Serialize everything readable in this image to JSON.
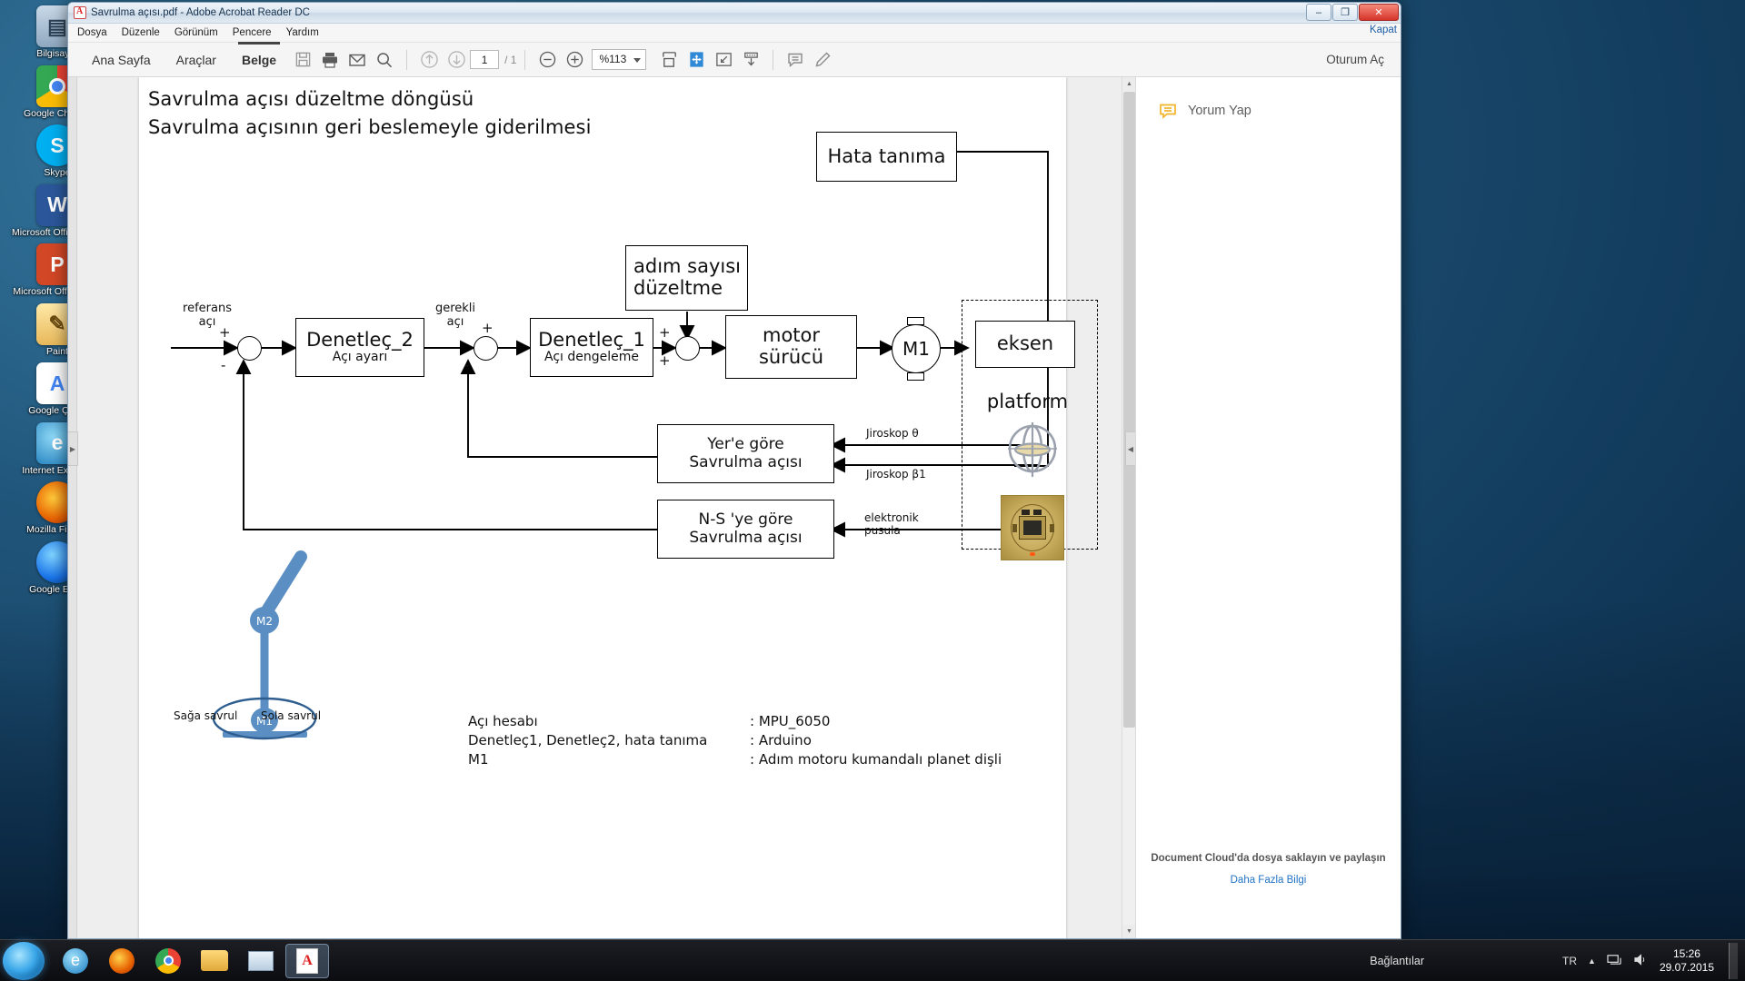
{
  "window": {
    "title": "Savrulma açısı.pdf - Adobe Acrobat Reader DC",
    "minimize": "–",
    "maximize": "❐",
    "close": "✕",
    "kapat_label": "Kapat"
  },
  "menubar": {
    "items": [
      "Dosya",
      "Düzenle",
      "Görünüm",
      "Pencere",
      "Yardım"
    ]
  },
  "toolbar": {
    "tabs": [
      {
        "label": "Ana Sayfa",
        "active": false
      },
      {
        "label": "Araçlar",
        "active": false
      },
      {
        "label": "Belge",
        "active": true
      }
    ],
    "page_current": "1",
    "page_total": "/ 1",
    "zoom_value": "%113",
    "sign_in": "Oturum Aç",
    "icons": [
      "save-icon",
      "print-icon",
      "email-icon",
      "search-icon",
      "previous-page-icon",
      "next-page-icon",
      "zoom-out-icon",
      "zoom-in-icon",
      "fit-page-icon",
      "pan-tool-icon",
      "fit-width-icon",
      "scroll-mode-icon",
      "comment-icon",
      "highlight-icon"
    ]
  },
  "right_panel": {
    "comment_label": "Yorum Yap",
    "promo_title": "Document Cloud'da dosya saklayın ve paylaşın",
    "promo_link": "Daha Fazla Bilgi"
  },
  "document": {
    "heading_line1": "Savrulma açısı düzeltme döngüsü",
    "heading_line2": "Savrulma açısının geri beslemeyle giderilmesi",
    "blocks": {
      "hata_tanima": "Hata tanıma",
      "adim_sayisi_1": "adım sayısı",
      "adim_sayisi_2": "düzeltme",
      "denetlec2_title": "Denetleç_2",
      "denetlec2_sub": "Açı ayarı",
      "denetlec1_title": "Denetleç_1",
      "denetlec1_sub": "Açı dengeleme",
      "motor_1": "motor",
      "motor_2": "sürücü",
      "m1": "M1",
      "eksen": "eksen",
      "platform": "platform",
      "yere_gore_1": "Yer'e göre",
      "yere_gore_2": "Savrulma açısı",
      "ns_gore_1": "N-S 'ye göre",
      "ns_gore_2": "Savrulma açısı"
    },
    "signal_labels": {
      "referans_1": "referans",
      "referans_2": "açı",
      "gerekli_1": "gerekli",
      "gerekli_2": "açı",
      "jiroskop_theta": "Jiroskop θ",
      "jiroskop_beta": "Jiroskop β1",
      "elektronik_1": "elektronik",
      "elektronik_2": "pusula",
      "saga_savrul": "Sağa savrul",
      "sola_savrul": "Sola savrul",
      "m2": "M2",
      "m1_pend": "M1"
    },
    "signs": {
      "plus": "+",
      "minus": "-"
    },
    "legend": [
      {
        "item": "Açı hesabı",
        "value": ": MPU_6050"
      },
      {
        "item": "Denetleç1, Denetleç2, hata tanıma",
        "value": ": Arduino"
      },
      {
        "item": "M1",
        "value": ": Adım motoru kumandalı planet dişli"
      }
    ]
  },
  "desktop_icons": [
    {
      "label": "Bilgisayar",
      "color": "#7a9bb8",
      "glyph": "Ὓ3",
      "short": "▣"
    },
    {
      "label": "Google Chrome",
      "color": "#ffffff",
      "glyph": "",
      "short": "◉"
    },
    {
      "label": "Skype",
      "color": "#00aff0",
      "glyph": "S",
      "short": "S"
    },
    {
      "label": "Microsoft Office Wo...",
      "color": "#2b579a",
      "glyph": "W",
      "short": "W"
    },
    {
      "label": "Microsoft Office Po...",
      "color": "#d24726",
      "glyph": "P",
      "short": "P"
    },
    {
      "label": "Paint",
      "color": "#f2a93b",
      "glyph": "✎",
      "short": "✎"
    },
    {
      "label": "Google Çeviri",
      "color": "#4285f4",
      "glyph": "A",
      "short": "A"
    },
    {
      "label": "Internet Explorer",
      "color": "#1ebbee",
      "glyph": "e",
      "short": "e"
    },
    {
      "label": "Mozilla Firefox",
      "color": "#e66000",
      "glyph": "●",
      "short": "◔"
    },
    {
      "label": "Google Earth",
      "color": "#1a73e8",
      "glyph": "●",
      "short": "○"
    }
  ],
  "taskbar": {
    "items": [
      "ie-icon",
      "firefox-icon",
      "chrome-icon",
      "explorer-icon",
      "window-icon",
      "acrobat-icon"
    ],
    "connections_label": "Bağlantılar",
    "language": "TR",
    "time": "15:26",
    "date": "29.07.2015"
  }
}
